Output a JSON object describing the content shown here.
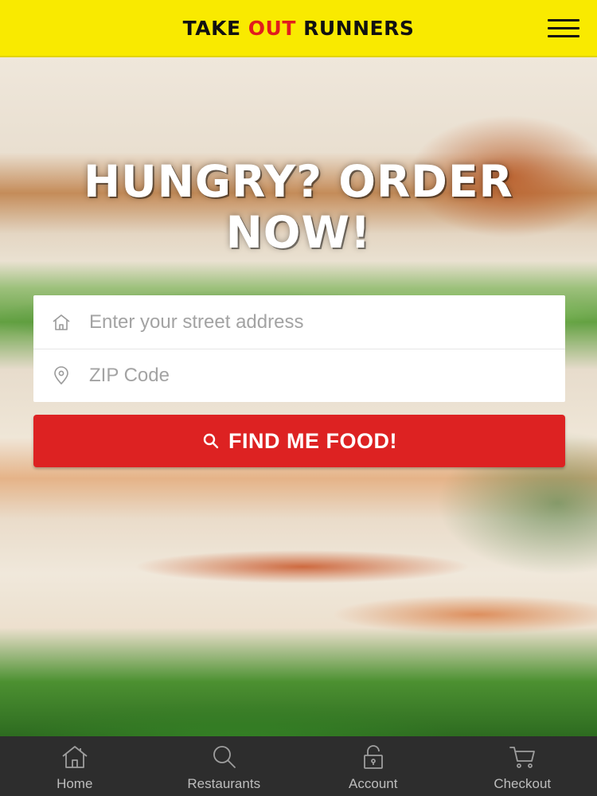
{
  "header": {
    "brand_part1": "TAKE ",
    "brand_accent": "OUT",
    "brand_part2": " RUNNERS",
    "menu_icon": "hamburger-menu-icon"
  },
  "hero": {
    "headline_line1": "HUNGRY? ORDER",
    "headline_line2": "NOW!"
  },
  "form": {
    "address_placeholder": "Enter your street address",
    "address_icon": "home-icon",
    "zip_placeholder": "ZIP Code",
    "zip_icon": "location-pin-icon",
    "submit_label": "FIND ME FOOD!",
    "submit_icon": "search-icon"
  },
  "tabbar": {
    "items": [
      {
        "label": "Home",
        "icon": "home-icon"
      },
      {
        "label": "Restaurants",
        "icon": "search-icon"
      },
      {
        "label": "Account",
        "icon": "lock-icon"
      },
      {
        "label": "Checkout",
        "icon": "cart-icon"
      }
    ]
  },
  "colors": {
    "header_bg": "#f9ea00",
    "brand_accent": "#e11d1d",
    "button_bg": "#dd2222",
    "tabbar_bg": "#2d2d2d"
  }
}
